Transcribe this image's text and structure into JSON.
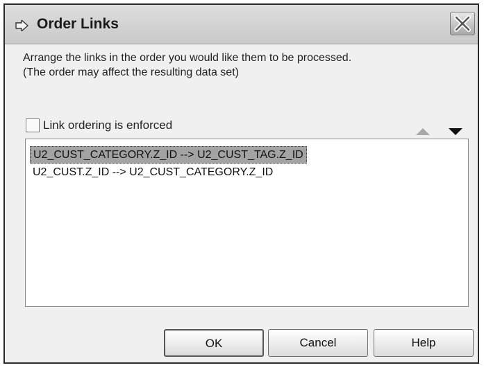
{
  "dialog": {
    "title": "Order Links",
    "description_line1": "Arrange the links in the order you would like them to be processed.",
    "description_line2": "(The order may affect the resulting data set)",
    "checkbox": {
      "label": "Link ordering is enforced",
      "checked": false
    },
    "links": [
      {
        "text": "U2_CUST_CATEGORY.Z_ID --> U2_CUST_TAG.Z_ID",
        "selected": true
      },
      {
        "text": "U2_CUST.Z_ID --> U2_CUST_CATEGORY.Z_ID",
        "selected": false
      }
    ],
    "buttons": {
      "ok": "OK",
      "cancel": "Cancel",
      "help": "Help"
    }
  },
  "icons": {
    "title": "arrow-right-icon",
    "close": "close-icon",
    "move_up": "triangle-up-icon",
    "move_down": "triangle-down-icon"
  },
  "colors": {
    "selection": "#a3a3a3",
    "move_up_disabled": "#a8a8a8",
    "move_down": "#111111"
  }
}
